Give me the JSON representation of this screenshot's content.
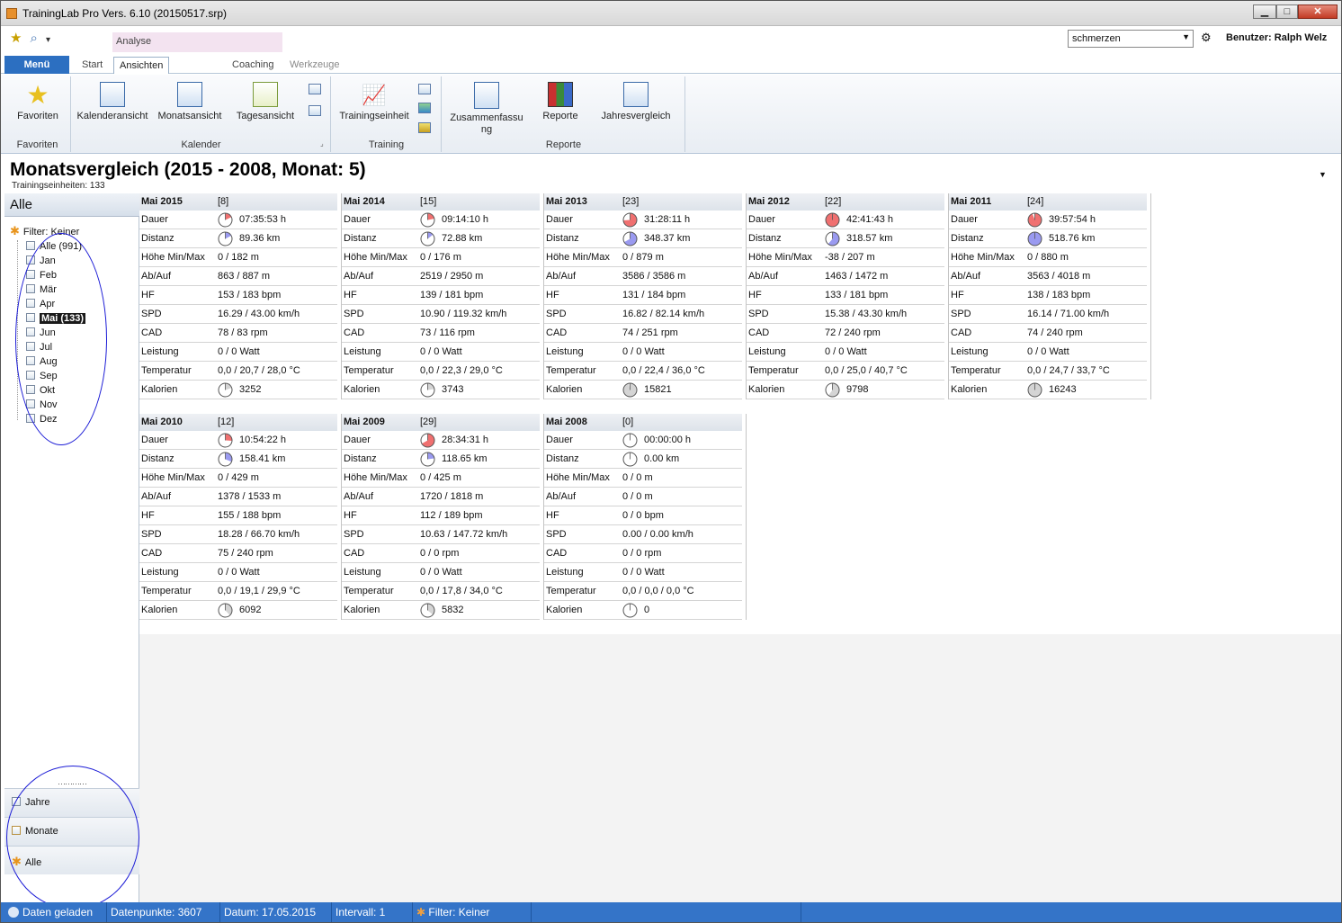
{
  "window": {
    "title": "TrainingLab Pro Vers. 6.10 (20150517.srp)",
    "min": "▁",
    "max": "□",
    "close": "✕"
  },
  "quick_access": {
    "dropdown": "▾"
  },
  "ribbon": {
    "menu_label": "Menü",
    "context_tab": "Analyse",
    "tabs": [
      "Start",
      "Ansichten",
      "Coaching",
      "Werkzeuge"
    ],
    "groups": {
      "favoriten": {
        "label": "Favoriten",
        "buttons": [
          "Favoriten"
        ]
      },
      "kalender": {
        "label": "Kalender",
        "buttons": [
          "Kalenderansicht",
          "Monatsansicht",
          "Tagesansicht"
        ]
      },
      "training": {
        "label": "Training",
        "buttons": [
          "Trainingseinheit"
        ]
      },
      "reporte": {
        "label": "Reporte",
        "buttons": [
          "Zusammenfassu\nng",
          "Reporte",
          "Jahresvergleich"
        ]
      }
    }
  },
  "header": {
    "combo_value": "schmerzen",
    "user": "Benutzer: Ralph Welz"
  },
  "page": {
    "title": "Monatsvergleich (2015 - 2008, Monat: 5)",
    "subtitle": "Trainingseinheiten: 133"
  },
  "nav": {
    "title": "Alle",
    "filter": "Filter: Keiner",
    "items": [
      "Alle (991)",
      "Jan",
      "Feb",
      "Mär",
      "Apr",
      "Mai (133)",
      "Jun",
      "Jul",
      "Aug",
      "Sep",
      "Okt",
      "Nov",
      "Dez"
    ],
    "selected_index": 5,
    "bottom": [
      "Jahre",
      "Monate",
      "Alle"
    ]
  },
  "colors": {
    "accent": "#3474c8",
    "pie_dauer": "#f07070",
    "pie_distanz": "#9a9af0",
    "pie_kalorien": "#d4d4d4",
    "annotation": "#1b1bd6"
  },
  "row_labels": [
    "Dauer",
    "Distanz",
    "Höhe Min/Max",
    "Ab/Auf",
    "HF",
    "SPD",
    "CAD",
    "Leistung",
    "Temperatur",
    "Kalorien"
  ],
  "cards": [
    {
      "title": "Mai 2015",
      "count": "[8]",
      "values": [
        "07:35:53 h",
        "89.36 km",
        "0 / 182 m",
        "863 / 887 m",
        "153 / 183 bpm",
        "16.29 / 43.00 km/h",
        "78 / 83 rpm",
        "0 / 0 Watt",
        "0,0 / 20,7 / 28,0 °C",
        "3252"
      ],
      "fractions": [
        0.18,
        0.17,
        0.2
      ]
    },
    {
      "title": "Mai 2014",
      "count": "[15]",
      "values": [
        "09:14:10 h",
        "72.88 km",
        "0 / 176 m",
        "2519 / 2950 m",
        "139 / 181 bpm",
        "10.90 / 119.32 km/h",
        "73 / 116 rpm",
        "0 / 0 Watt",
        "0,0 / 22,3 / 29,0 °C",
        "3743"
      ],
      "fractions": [
        0.22,
        0.14,
        0.23
      ]
    },
    {
      "title": "Mai 2013",
      "count": "[23]",
      "values": [
        "31:28:11 h",
        "348.37 km",
        "0 / 879 m",
        "3586 / 3586 m",
        "131 / 184 bpm",
        "16.82 / 82.14 km/h",
        "74 / 251 rpm",
        "0 / 0 Watt",
        "0,0 / 22,4 / 36,0 °C",
        "15821"
      ],
      "fractions": [
        0.74,
        0.67,
        0.97
      ]
    },
    {
      "title": "Mai 2012",
      "count": "[22]",
      "values": [
        "42:41:43 h",
        "318.57 km",
        "-38 / 207 m",
        "1463 / 1472 m",
        "133 / 181 bpm",
        "15.38 / 43.30 km/h",
        "72 / 240 rpm",
        "0 / 0 Watt",
        "0,0 / 25,0 / 40,7 °C",
        "9798"
      ],
      "fractions": [
        1.0,
        0.61,
        0.6
      ]
    },
    {
      "title": "Mai 2011",
      "count": "[24]",
      "values": [
        "39:57:54 h",
        "518.76 km",
        "0 / 880 m",
        "3563 / 4018 m",
        "138 / 183 bpm",
        "16.14 / 71.00 km/h",
        "74 / 240 rpm",
        "0 / 0 Watt",
        "0,0 / 24,7 / 33,7 °C",
        "16243"
      ],
      "fractions": [
        0.94,
        1.0,
        1.0
      ]
    },
    {
      "title": "Mai 2010",
      "count": "[12]",
      "values": [
        "10:54:22 h",
        "158.41 km",
        "0 / 429 m",
        "1378 / 1533 m",
        "155 / 188 bpm",
        "18.28 / 66.70 km/h",
        "75 / 240 rpm",
        "0 / 0 Watt",
        "0,0 / 19,1 / 29,9 °C",
        "6092"
      ],
      "fractions": [
        0.26,
        0.31,
        0.38
      ]
    },
    {
      "title": "Mai 2009",
      "count": "[29]",
      "values": [
        "28:34:31 h",
        "118.65 km",
        "0 / 425 m",
        "1720 / 1818 m",
        "112 / 189 bpm",
        "10.63 / 147.72 km/h",
        "0 / 0 rpm",
        "0 / 0 Watt",
        "0,0 / 17,8 / 34,0 °C",
        "5832"
      ],
      "fractions": [
        0.67,
        0.23,
        0.36
      ]
    },
    {
      "title": "Mai 2008",
      "count": "[0]",
      "values": [
        "00:00:00 h",
        "0.00 km",
        "0 / 0 m",
        "0 / 0 m",
        "0 / 0 bpm",
        "0.00 / 0.00 km/h",
        "0 / 0 rpm",
        "0 / 0 Watt",
        "0,0 / 0,0 / 0,0 °C",
        "0"
      ],
      "fractions": [
        0,
        0,
        0
      ]
    }
  ],
  "status": {
    "loaded": "Daten geladen",
    "points": "Datenpunkte: 3607",
    "date": "Datum: 17.05.2015",
    "interval": "Intervall: 1",
    "filter": "Filter: Keiner"
  }
}
